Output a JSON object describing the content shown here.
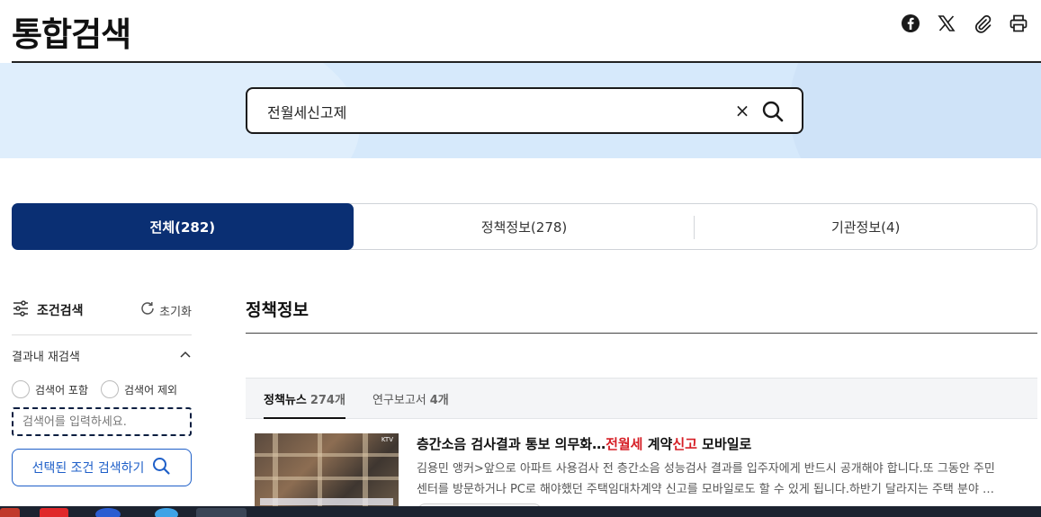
{
  "page": {
    "title": "통합검색"
  },
  "share": {
    "icons": [
      "facebook-icon",
      "x-icon",
      "paperclip-icon",
      "print-icon"
    ]
  },
  "search": {
    "value": "전월세신고제",
    "clear_label": "×"
  },
  "tabs": [
    {
      "label": "전체(282)",
      "active": true
    },
    {
      "label": "정책정보(278)",
      "active": false
    },
    {
      "label": "기관정보(4)",
      "active": false
    }
  ],
  "sidebar": {
    "title": "조건검색",
    "reset_label": "초기화",
    "research_label": "결과내 재검색",
    "include_label": "검색어 포함",
    "exclude_label": "검색어 제외",
    "keyword_placeholder": "검색어를 입력하세요.",
    "apply_label": "선택된 조건 검색하기"
  },
  "main": {
    "section_title": "정책정보",
    "subtabs": [
      {
        "label": "정책뉴스",
        "count": "274개",
        "active": true
      },
      {
        "label": "연구보고서",
        "count": "4개",
        "active": false
      }
    ],
    "news": {
      "title_prefix": "층간소음 검사결과 통보 의무화…",
      "title_hl1": "전월세",
      "title_mid": " 계약",
      "title_hl2": "신고",
      "title_suffix": " 모바일로",
      "body_line1": "김용민 앵커>앞으로 아파트 사용검사 전 층간소음 성능검사 결과를 입주자에게 반드시 공개해야 합니다.또 그동안 주민",
      "body_line2": "센터를 방문하거나 PC로 해야했던 주택임대차계약 신고를 모바일로도 할 수 있게 됩니다.하반기 달라지는 주택 분야 …",
      "thumb_logo": "KTV"
    }
  },
  "colors": {
    "primary": "#0a2f73",
    "accent": "#1e5fc8",
    "highlight": "#d61f26",
    "band": "#d6e9fb"
  }
}
